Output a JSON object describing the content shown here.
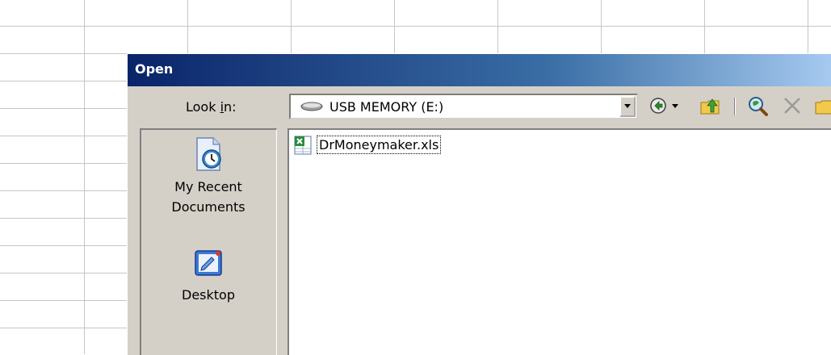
{
  "dialog": {
    "title": "Open",
    "look_in_label_prefix": "Look ",
    "look_in_label_hotkey": "i",
    "look_in_label_suffix": "n:",
    "look_in_value": "USB MEMORY (E:)",
    "toolbar": {
      "back_icon": "back-arrow-icon",
      "up_icon": "up-one-level-icon",
      "search_icon": "search-the-web-icon",
      "delete_icon": "delete-icon",
      "new_folder_icon": "create-new-folder-icon"
    }
  },
  "places": [
    {
      "label_line1": "My Recent",
      "label_line2": "Documents",
      "icon": "recent-documents-icon"
    },
    {
      "label_line1": "Desktop",
      "label_line2": "",
      "icon": "desktop-icon"
    }
  ],
  "files": [
    {
      "name": "DrMoneymaker.xls",
      "icon": "excel-file-icon"
    }
  ],
  "colors": {
    "title_start": "#0a246a",
    "title_end": "#a6caf0",
    "dialog_face": "#d4d0c8"
  }
}
